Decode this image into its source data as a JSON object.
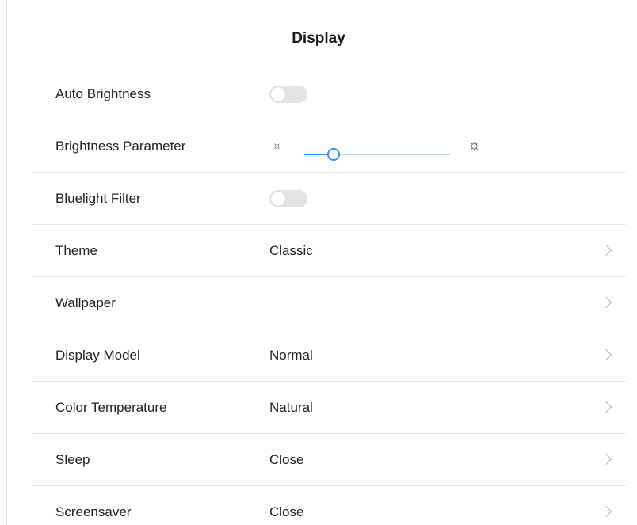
{
  "header": {
    "title": "Display"
  },
  "rows": {
    "auto_brightness": {
      "label": "Auto Brightness",
      "enabled": false
    },
    "brightness": {
      "label": "Brightness Parameter",
      "level": 0.2,
      "min_icon": "sun-small-icon",
      "max_icon": "sun-large-icon"
    },
    "bluelight": {
      "label": "Bluelight Filter",
      "enabled": false
    },
    "theme": {
      "label": "Theme",
      "value": "Classic"
    },
    "wallpaper": {
      "label": "Wallpaper",
      "value": ""
    },
    "display_model": {
      "label": "Display Model",
      "value": "Normal"
    },
    "color_temperature": {
      "label": "Color Temperature",
      "value": "Natural"
    },
    "sleep": {
      "label": "Sleep",
      "value": "Close"
    },
    "screensaver": {
      "label": "Screensaver",
      "value": "Close"
    }
  },
  "colors": {
    "accent": "#3b8ff0",
    "track": "#b9d6f7",
    "toggle_off": "#e3e3e3",
    "divider": "#e8e8e8",
    "chevron": "#b5b5b5"
  }
}
